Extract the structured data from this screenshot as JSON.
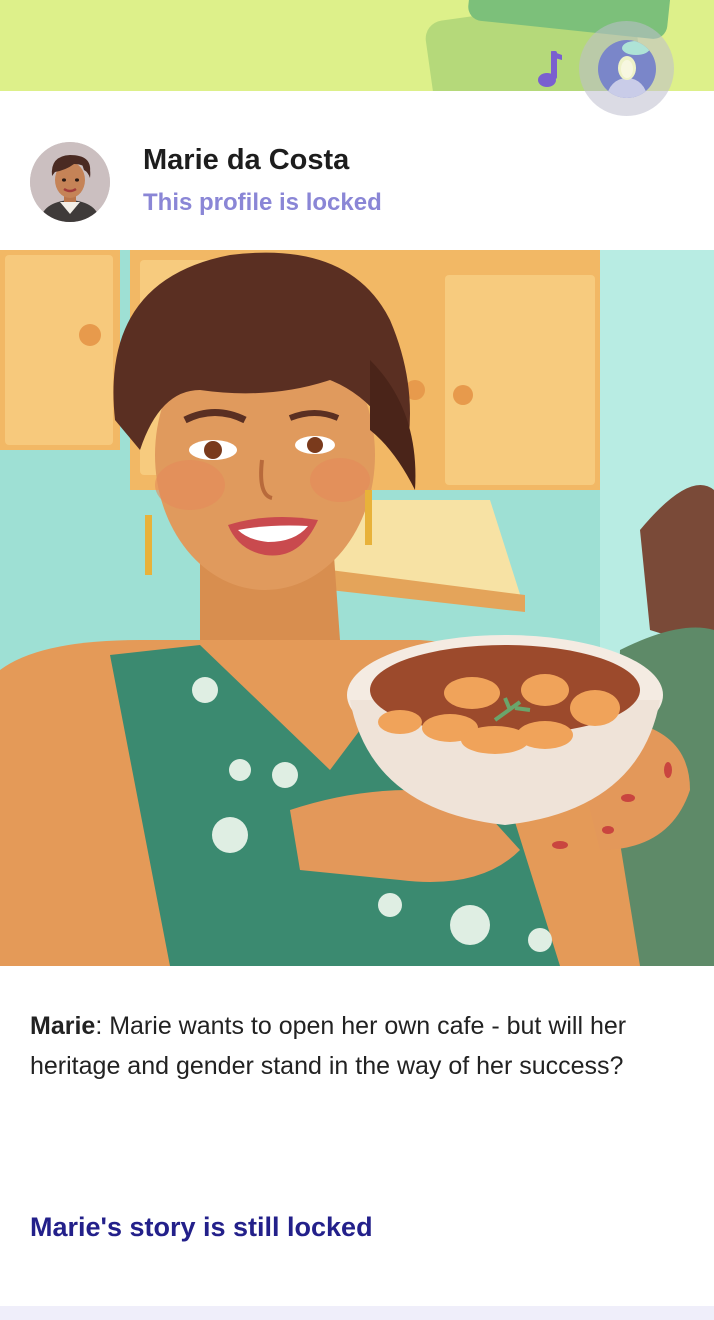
{
  "profile": {
    "name": "Marie da Costa",
    "status": "This profile is locked"
  },
  "description": {
    "speaker": "Marie",
    "text": ": Marie wants to open her own cafe - but will her heritage and gender stand in the way of her success?"
  },
  "story_link": "Marie's story is still locked",
  "icons": {
    "music": "music-note-icon",
    "user": "user-avatar-icon"
  },
  "colors": {
    "banner": "#ddf08a",
    "status_text": "#8a86d6",
    "link_text": "#23208a",
    "music_icon": "#7a5fd0"
  }
}
